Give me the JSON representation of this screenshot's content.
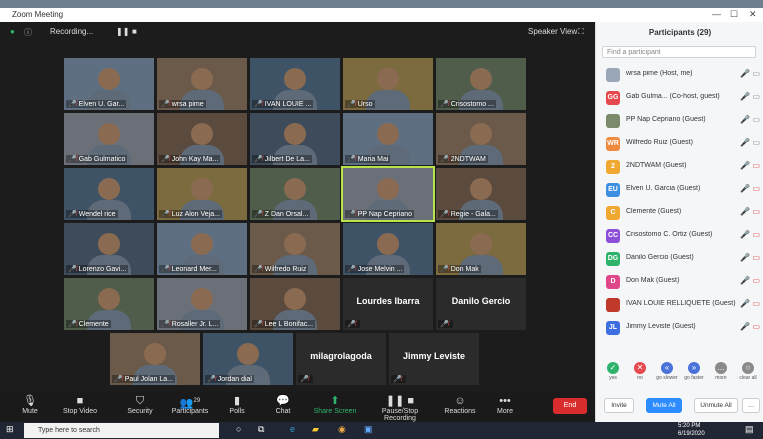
{
  "window": {
    "title": "Zoom Meeting"
  },
  "meeting": {
    "recording": "Recording...",
    "view_label": "Speaker View"
  },
  "tiles": [
    {
      "name": "Elven U. Gar..."
    },
    {
      "name": "wrsa pime"
    },
    {
      "name": "IVAN LOUIE ..."
    },
    {
      "name": "Urso"
    },
    {
      "name": "Crisostomo ..."
    },
    {
      "name": "Gab Gulmatico"
    },
    {
      "name": "John Kay Ma..."
    },
    {
      "name": "Jilbert De La..."
    },
    {
      "name": "Maria Mai"
    },
    {
      "name": "2NDTWAM"
    },
    {
      "name": "Wendel rice"
    },
    {
      "name": "Luz Alon Veja..."
    },
    {
      "name": "Z Dan Orsal..."
    },
    {
      "name": "PP Nap Cepriano"
    },
    {
      "name": "Regie - Gala..."
    },
    {
      "name": "Lorenzo Gavi..."
    },
    {
      "name": "Leonard Mer..."
    },
    {
      "name": "Wilfredo Ruiz"
    },
    {
      "name": "Jose Melvin ..."
    },
    {
      "name": "Don Mak"
    },
    {
      "name": "Clemente"
    },
    {
      "name": "Rosaller Jr. L..."
    },
    {
      "name": "Lee L Bonifac..."
    },
    {
      "name": "",
      "big": "Lourdes Ibarra"
    },
    {
      "name": "",
      "big": "Danilo Gercio"
    },
    {
      "name": "Paul Jolan La..."
    },
    {
      "name": "Jordan dial"
    },
    {
      "name": "",
      "big": "milagrolagoda"
    },
    {
      "name": "",
      "big": "Jimmy Leviste"
    }
  ],
  "toolbar": {
    "mute": "Mute",
    "video": "Stop Video",
    "security": "Security",
    "participants": "Participants",
    "participants_count": "29",
    "polls": "Polls",
    "chat": "Chat",
    "share": "Share Screen",
    "record": "Pause/Stop Recording",
    "reactions": "Reactions",
    "more": "More",
    "end": "End"
  },
  "panel": {
    "title": "Participants (29)",
    "search_placeholder": "Find a participant",
    "participants": [
      {
        "name": "wrsa pime (Host, me)",
        "initials": "",
        "color": "#9aa7b8"
      },
      {
        "name": "Gab Gulma... (Co-host, guest)",
        "initials": "GG",
        "color": "#e5484d"
      },
      {
        "name": "PP Nap Cepriano (Guest)",
        "initials": "",
        "color": "#7a8a6a"
      },
      {
        "name": "Wilfredo Ruiz (Guest)",
        "initials": "WR",
        "color": "#f08a3e"
      },
      {
        "name": "2NDTWAM (Guest)",
        "initials": "2",
        "color": "#f0a830"
      },
      {
        "name": "Elven U. Garcia (Guest)",
        "initials": "EU",
        "color": "#3d8fe0"
      },
      {
        "name": "Clemente (Guest)",
        "initials": "C",
        "color": "#f0a830"
      },
      {
        "name": "Crisostomo C. Ortiz (Guest)",
        "initials": "CC",
        "color": "#8b4fd8"
      },
      {
        "name": "Danilo Gercio (Guest)",
        "initials": "DG",
        "color": "#2fb36b"
      },
      {
        "name": "Don Mak (Guest)",
        "initials": "D",
        "color": "#e0468a"
      },
      {
        "name": "IVAN LOUIE RELLIQUETE (Guest)",
        "initials": "",
        "color": "#c0392b"
      },
      {
        "name": "Jimmy Leviste (Guest)",
        "initials": "JL",
        "color": "#3d6fe0"
      }
    ],
    "reactions": [
      {
        "label": "yes",
        "glyph": "✓",
        "color": "#2fb36b"
      },
      {
        "label": "no",
        "glyph": "✕",
        "color": "#e5484d"
      },
      {
        "label": "go slower",
        "glyph": "«",
        "color": "#4a72d8"
      },
      {
        "label": "go faster",
        "glyph": "»",
        "color": "#4a72d8"
      },
      {
        "label": "more",
        "glyph": "…",
        "color": "#8a8a8a"
      },
      {
        "label": "clear all",
        "glyph": "○",
        "color": "#8a8a8a"
      }
    ],
    "invite": "Invite",
    "mute_all": "Mute All",
    "unmute_all": "Unmute All"
  },
  "taskbar": {
    "search": "Type here to search",
    "time": "5:20 PM",
    "date": "6/19/2020"
  }
}
